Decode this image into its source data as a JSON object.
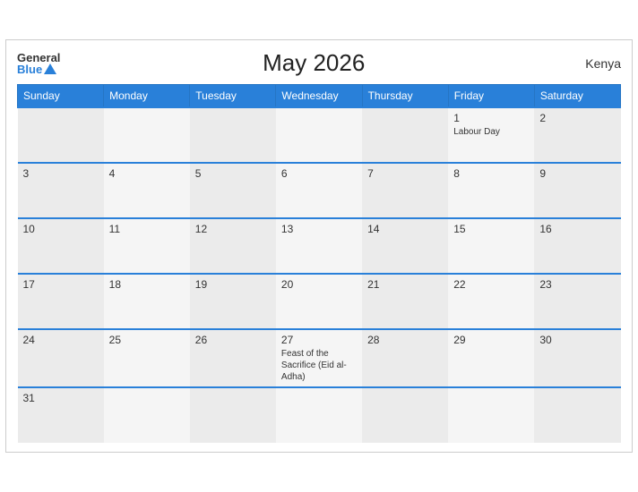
{
  "header": {
    "logo_general": "General",
    "logo_blue": "Blue",
    "title": "May 2026",
    "country": "Kenya"
  },
  "weekdays": [
    "Sunday",
    "Monday",
    "Tuesday",
    "Wednesday",
    "Thursday",
    "Friday",
    "Saturday"
  ],
  "weeks": [
    [
      {
        "day": "",
        "event": ""
      },
      {
        "day": "",
        "event": ""
      },
      {
        "day": "",
        "event": ""
      },
      {
        "day": "",
        "event": ""
      },
      {
        "day": "",
        "event": ""
      },
      {
        "day": "1",
        "event": "Labour Day"
      },
      {
        "day": "2",
        "event": ""
      }
    ],
    [
      {
        "day": "3",
        "event": ""
      },
      {
        "day": "4",
        "event": ""
      },
      {
        "day": "5",
        "event": ""
      },
      {
        "day": "6",
        "event": ""
      },
      {
        "day": "7",
        "event": ""
      },
      {
        "day": "8",
        "event": ""
      },
      {
        "day": "9",
        "event": ""
      }
    ],
    [
      {
        "day": "10",
        "event": ""
      },
      {
        "day": "11",
        "event": ""
      },
      {
        "day": "12",
        "event": ""
      },
      {
        "day": "13",
        "event": ""
      },
      {
        "day": "14",
        "event": ""
      },
      {
        "day": "15",
        "event": ""
      },
      {
        "day": "16",
        "event": ""
      }
    ],
    [
      {
        "day": "17",
        "event": ""
      },
      {
        "day": "18",
        "event": ""
      },
      {
        "day": "19",
        "event": ""
      },
      {
        "day": "20",
        "event": ""
      },
      {
        "day": "21",
        "event": ""
      },
      {
        "day": "22",
        "event": ""
      },
      {
        "day": "23",
        "event": ""
      }
    ],
    [
      {
        "day": "24",
        "event": ""
      },
      {
        "day": "25",
        "event": ""
      },
      {
        "day": "26",
        "event": ""
      },
      {
        "day": "27",
        "event": "Feast of the Sacrifice (Eid al-Adha)"
      },
      {
        "day": "28",
        "event": ""
      },
      {
        "day": "29",
        "event": ""
      },
      {
        "day": "30",
        "event": ""
      }
    ],
    [
      {
        "day": "31",
        "event": ""
      },
      {
        "day": "",
        "event": ""
      },
      {
        "day": "",
        "event": ""
      },
      {
        "day": "",
        "event": ""
      },
      {
        "day": "",
        "event": ""
      },
      {
        "day": "",
        "event": ""
      },
      {
        "day": "",
        "event": ""
      }
    ]
  ]
}
